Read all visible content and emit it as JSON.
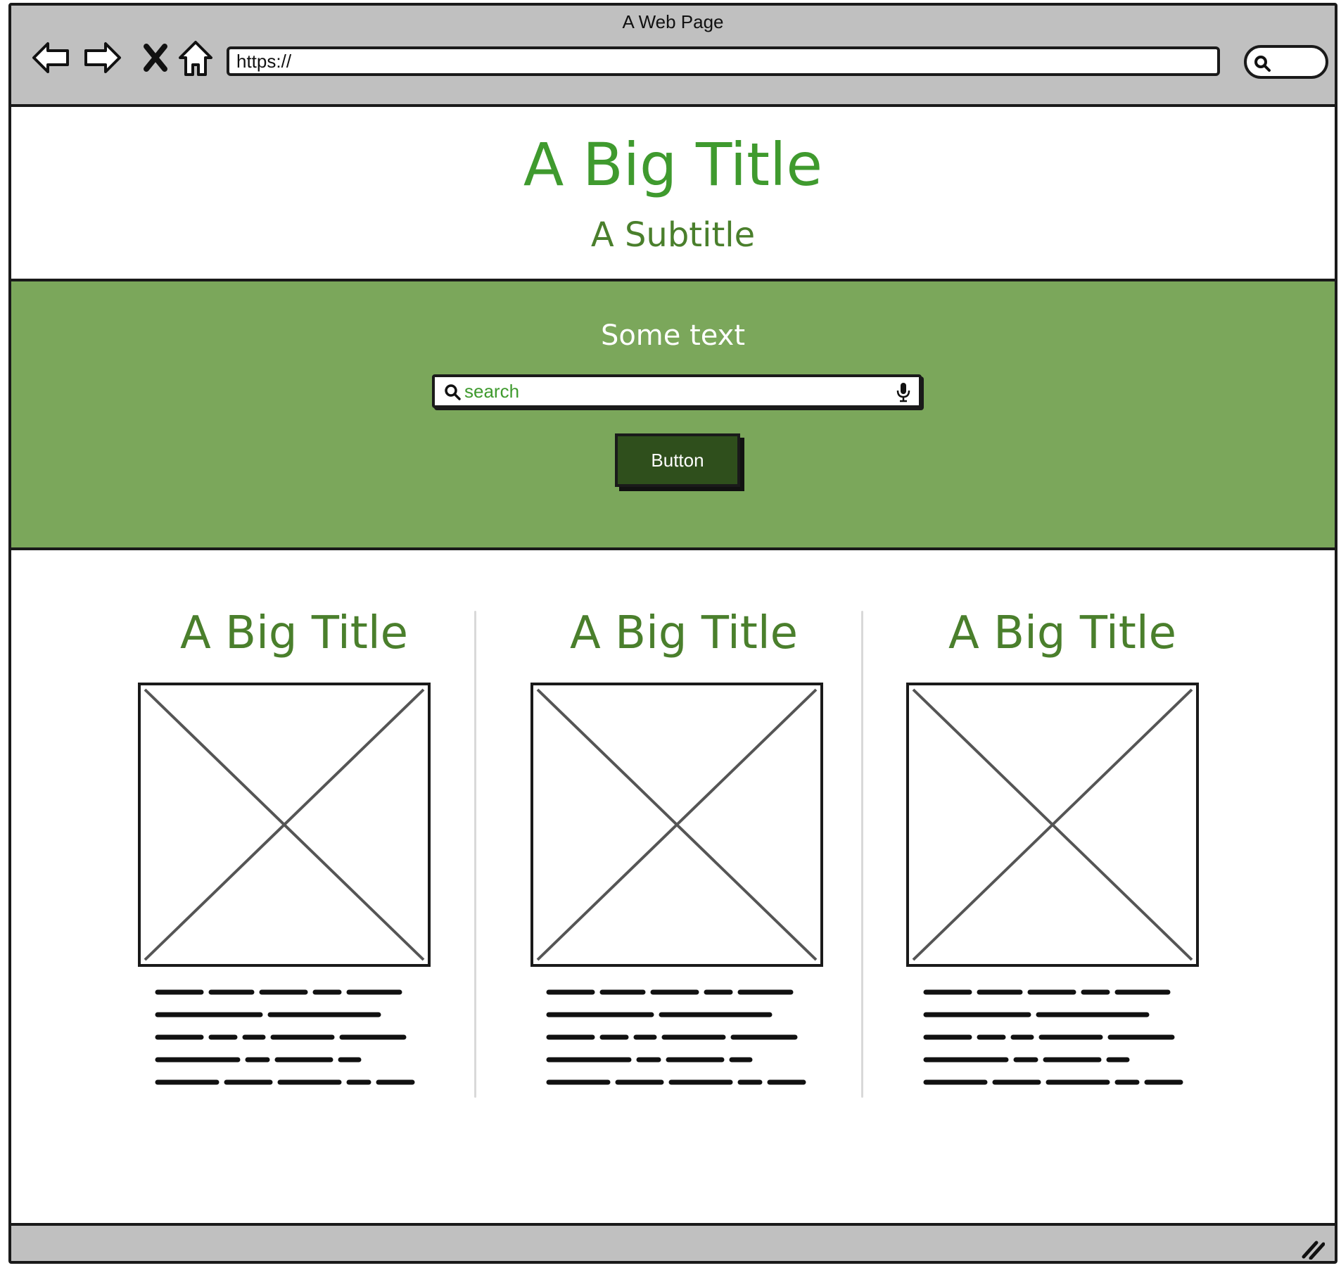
{
  "browser": {
    "title": "A Web Page",
    "url": "https://",
    "icons": [
      "back-icon",
      "forward-icon",
      "stop-icon",
      "home-icon",
      "search-icon"
    ]
  },
  "hero": {
    "title": "A Big Title",
    "subtitle": "A Subtitle"
  },
  "band": {
    "text": "Some text",
    "search_placeholder": "search",
    "button_label": "Button"
  },
  "columns": [
    {
      "title": "A Big Title"
    },
    {
      "title": "A Big Title"
    },
    {
      "title": "A Big Title"
    }
  ],
  "colors": {
    "title_green": "#3f9a2e",
    "dark_green": "#4a7f2c",
    "band_green": "#7ba75b",
    "button_green": "#2f4f1c",
    "chrome_gray": "#c0c0c0"
  }
}
